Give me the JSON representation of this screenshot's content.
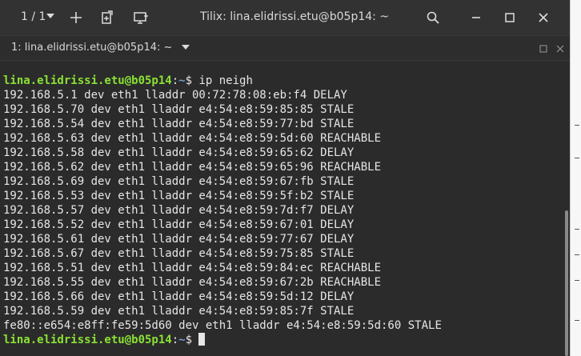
{
  "titlebar": {
    "session_indicator": "1 / 1",
    "title": "Tilix: lina.elidrissi.etu@b05p14: ~",
    "icons": [
      "chevron-down-icon",
      "add-terminal-icon",
      "detach-icon",
      "new-window-icon",
      "search-icon",
      "minimize-icon",
      "maximize-icon",
      "close-icon"
    ]
  },
  "terminal_header": {
    "label": "1: lina.elidrissi.etu@b05p14: ~"
  },
  "terminal": {
    "prompt_user": "lina.elidrissi.etu@b05p14",
    "prompt_sep": ":",
    "prompt_path": "~",
    "prompt_symbol": "$ ",
    "command": "ip neigh",
    "output": [
      "192.168.5.1 dev eth1 lladdr 00:72:78:08:eb:f4 DELAY",
      "192.168.5.70 dev eth1 lladdr e4:54:e8:59:85:85 STALE",
      "192.168.5.54 dev eth1 lladdr e4:54:e8:59:77:bd STALE",
      "192.168.5.63 dev eth1 lladdr e4:54:e8:59:5d:60 REACHABLE",
      "192.168.5.58 dev eth1 lladdr e4:54:e8:59:65:62 DELAY",
      "192.168.5.62 dev eth1 lladdr e4:54:e8:59:65:96 REACHABLE",
      "192.168.5.69 dev eth1 lladdr e4:54:e8:59:67:fb STALE",
      "192.168.5.53 dev eth1 lladdr e4:54:e8:59:5f:b2 STALE",
      "192.168.5.57 dev eth1 lladdr e4:54:e8:59:7d:f7 DELAY",
      "192.168.5.52 dev eth1 lladdr e4:54:e8:59:67:01 DELAY",
      "192.168.5.61 dev eth1 lladdr e4:54:e8:59:77:67 DELAY",
      "192.168.5.67 dev eth1 lladdr e4:54:e8:59:75:85 STALE",
      "192.168.5.51 dev eth1 lladdr e4:54:e8:59:84:ec REACHABLE",
      "192.168.5.55 dev eth1 lladdr e4:54:e8:59:67:2b REACHABLE",
      "192.168.5.66 dev eth1 lladdr e4:54:e8:59:5d:12 DELAY",
      "192.168.5.59 dev eth1 lladdr e4:54:e8:59:85:7f STALE",
      "fe80::e654:e8ff:fe59:5d60 dev eth1 lladdr e4:54:e8:59:5d:60 STALE"
    ]
  },
  "colors": {
    "background": "#2b2b2b",
    "prompt_user": "#8ae234",
    "prompt_path": "#729fcf",
    "text": "#e6e6e6"
  }
}
